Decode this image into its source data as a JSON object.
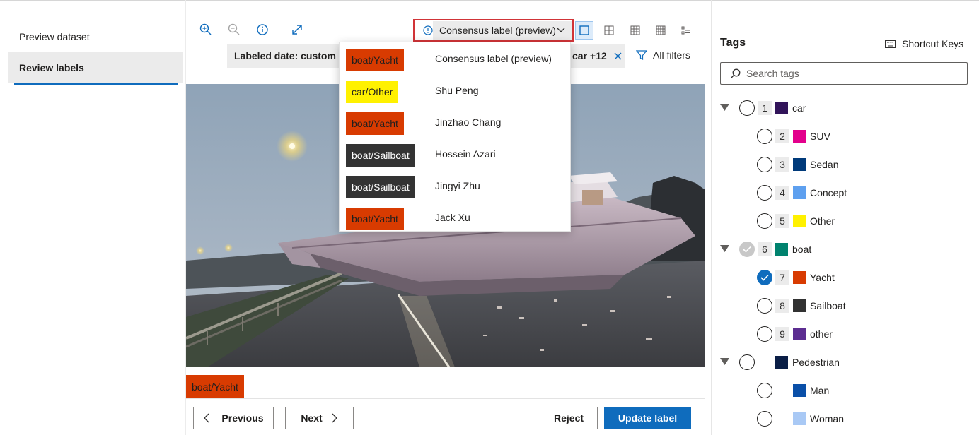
{
  "nav": {
    "items": [
      {
        "label": "Preview dataset"
      },
      {
        "label": "Review labels"
      }
    ]
  },
  "toolbar": {
    "icons": [
      "zoom-in-icon",
      "zoom-out-icon",
      "info-icon",
      "expand-icon"
    ],
    "consensus_label": "Consensus label (preview)",
    "view_icons": [
      "single-view-icon",
      "grid-small-icon",
      "grid-medium-icon",
      "grid-large-icon",
      "list-view-icon"
    ]
  },
  "filters": {
    "labeled_date": "Labeled date: custom",
    "tags_pill": "car +12",
    "all_filters": "All filters"
  },
  "image": {
    "chip_label": "boat/Yacht",
    "chip_color": "#d83b01"
  },
  "actions": {
    "previous": "Previous",
    "next": "Next",
    "reject": "Reject",
    "update": "Update label"
  },
  "dropdown": {
    "rows": [
      {
        "label": "boat/Yacht",
        "name": "Consensus label (preview)",
        "bg": "#d83b01",
        "fg": "#201f1e"
      },
      {
        "label": "car/Other",
        "name": "Shu Peng",
        "bg": "#fff100",
        "fg": "#201f1e"
      },
      {
        "label": "boat/Yacht",
        "name": "Jinzhao Chang",
        "bg": "#d83b01",
        "fg": "#201f1e"
      },
      {
        "label": "boat/Sailboat",
        "name": "Hossein Azari",
        "bg": "#333333",
        "fg": "#ffffff"
      },
      {
        "label": "boat/Sailboat",
        "name": "Jingyi Zhu",
        "bg": "#333333",
        "fg": "#ffffff"
      },
      {
        "label": "boat/Yacht",
        "name": "Jack Xu",
        "bg": "#d83b01",
        "fg": "#201f1e"
      }
    ]
  },
  "tags": {
    "title": "Tags",
    "shortcut_keys": "Shortcut Keys",
    "search_placeholder": "Search tags",
    "items": [
      {
        "num": "1",
        "label": "car",
        "color": "#32145a",
        "level": 0,
        "state": "empty"
      },
      {
        "num": "2",
        "label": "SUV",
        "color": "#e3008c",
        "level": 1,
        "state": "empty"
      },
      {
        "num": "3",
        "label": "Sedan",
        "color": "#003a7a",
        "level": 1,
        "state": "empty"
      },
      {
        "num": "4",
        "label": "Concept",
        "color": "#5ea0ef",
        "level": 1,
        "state": "empty"
      },
      {
        "num": "5",
        "label": "Other",
        "color": "#fff100",
        "level": 1,
        "state": "empty"
      },
      {
        "num": "6",
        "label": "boat",
        "color": "#00826e",
        "level": 0,
        "state": "partial"
      },
      {
        "num": "7",
        "label": "Yacht",
        "color": "#d83b01",
        "level": 1,
        "state": "checked"
      },
      {
        "num": "8",
        "label": "Sailboat",
        "color": "#323232",
        "level": 1,
        "state": "empty"
      },
      {
        "num": "9",
        "label": "other",
        "color": "#5c2d91",
        "level": 1,
        "state": "empty"
      },
      {
        "num": "",
        "label": "Pedestrian",
        "color": "#0a1e46",
        "level": 0,
        "state": "empty"
      },
      {
        "num": "",
        "label": "Man",
        "color": "#0a4fa8",
        "level": 1,
        "state": "empty"
      },
      {
        "num": "",
        "label": "Woman",
        "color": "#a9c9f5",
        "level": 1,
        "state": "empty"
      }
    ]
  }
}
